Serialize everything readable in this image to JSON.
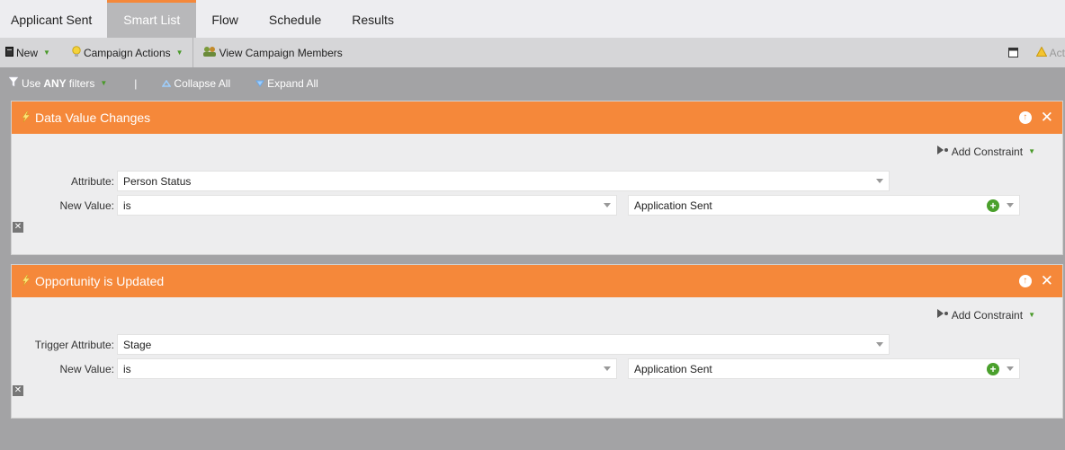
{
  "tabs": [
    {
      "label": "Applicant Sent",
      "active": false
    },
    {
      "label": "Smart List",
      "active": true
    },
    {
      "label": "Flow",
      "active": false
    },
    {
      "label": "Schedule",
      "active": false
    },
    {
      "label": "Results",
      "active": false
    }
  ],
  "toolbar": {
    "new_label": "New",
    "campaign_actions_label": "Campaign Actions",
    "view_members_label": "View Campaign Members",
    "right_cut_label": "Act"
  },
  "filterbar": {
    "use_label": "Use",
    "any_label": "ANY",
    "filters_label": "filters",
    "pipe": "|",
    "collapse_label": "Collapse All",
    "expand_label": "Expand All"
  },
  "filters": [
    {
      "title": "Data Value Changes",
      "add_constraint": "Add Constraint",
      "attr_label": "Attribute:",
      "attr_value": "Person Status",
      "newval_label": "New Value:",
      "operator": "is",
      "value": "Application Sent"
    },
    {
      "title": "Opportunity is Updated",
      "add_constraint": "Add Constraint",
      "attr_label": "Trigger Attribute:",
      "attr_value": "Stage",
      "newval_label": "New Value:",
      "operator": "is",
      "value": "Application Sent"
    }
  ],
  "colors": {
    "accent": "#f5883a",
    "add_green": "#4aa02c"
  }
}
